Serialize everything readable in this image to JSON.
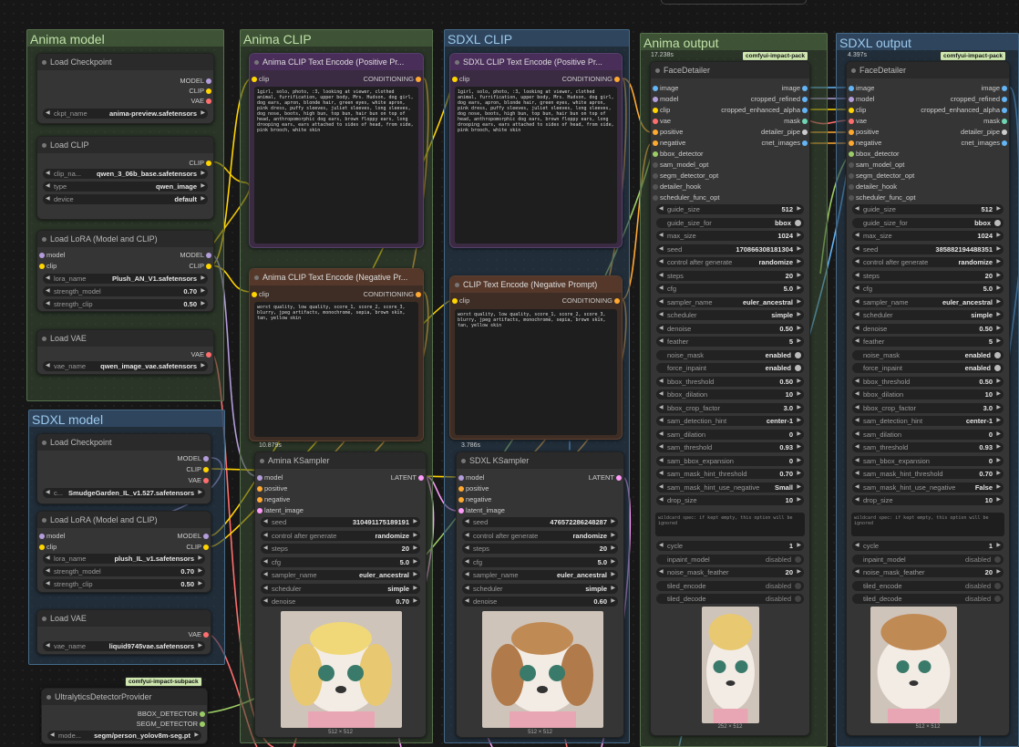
{
  "groups": {
    "anima_model": "Anima model",
    "anima_clip": "Anima CLIP",
    "sdxl_clip": "SDXL CLIP",
    "anima_output": "Anima output",
    "sdxl_output": "SDXL output",
    "sdxl_model": "SDXL model"
  },
  "nodes": {
    "anima_ckpt": {
      "title": "Load Checkpoint",
      "out": [
        "MODEL",
        "CLIP",
        "VAE"
      ],
      "ckpt_label": "ckpt_name",
      "ckpt_value": "anima-preview.safetensors"
    },
    "anima_clip_loader": {
      "title": "Load CLIP",
      "out": "CLIP",
      "name_label": "clip_na...",
      "name_value": "qwen_3_06b_base.safetensors",
      "type_label": "type",
      "type_value": "qwen_image",
      "device_label": "device",
      "device_value": "default"
    },
    "anima_lora": {
      "title": "Load LoRA (Model and CLIP)",
      "in_model": "model",
      "in_clip": "clip",
      "out_model": "MODEL",
      "out_clip": "CLIP",
      "lora_label": "lora_name",
      "lora_value": "Plush_AN_V1.safetensors",
      "sm_label": "strength_model",
      "sm_value": "0.70",
      "sc_label": "strength_clip",
      "sc_value": "0.50"
    },
    "anima_vae": {
      "title": "Load VAE",
      "out": "VAE",
      "label": "vae_name",
      "value": "qwen_image_vae.safetensors"
    },
    "anima_pos": {
      "title": "Anima CLIP Text Encode (Positive Pr...",
      "in": "clip",
      "out": "CONDITIONING",
      "text": "1girl, solo, photo, :3, looking at viewer, clothed animal, furrification, upper body, Mrs. Hudson, dog girl, dog ears, apron, blonde hair, green eyes, white apron, pink dress, puffy sleeves, juliet sleeves, long sleeves, dog nose, boots, high bun, top bun, hair bun on top of head, anthropomorphic dog ears, brown floppy ears, long drooping ears, ears attached to sides of head, from side, pink brooch, white skin"
    },
    "anima_neg": {
      "title": "Anima CLIP Text Encode (Negative Pr...",
      "in": "clip",
      "out": "CONDITIONING",
      "text": "worst quality, low quality, score_1, score_2, score_3, blurry, jpeg artifacts, monochrome, sepia, brown skin, tan, yellow skin",
      "timer": "10.879s"
    },
    "sdxl_pos": {
      "title": "SDXL CLIP Text Encode (Positive Pr...",
      "in": "clip",
      "out": "CONDITIONING",
      "text": "1girl, solo, photo, :3, looking at viewer, clothed animal, furrification, upper body, Mrs. Hudson, dog girl, dog ears, apron, blonde hair, green eyes, white apron, pink dress, puffy sleeves, juliet sleeves, long sleeves, dog nose, boots, high bun, top bun, hair bun on top of head, anthropomorphic dog ears, brown floppy ears, long drooping ears, ears attached to sides of head, from side, pink brooch, white skin"
    },
    "sdxl_neg": {
      "title": "CLIP Text Encode (Negative Prompt)",
      "in": "clip",
      "out": "CONDITIONING",
      "text": "worst quality, low quality, score_1, score_2, score_3, blurry, jpeg artifacts, monochrome, sepia, brown skin, tan, yellow skin",
      "timer": "3.786s"
    },
    "anima_ks": {
      "title": "Amina KSampler",
      "in": [
        "model",
        "positive",
        "negative",
        "latent_image"
      ],
      "out": "LATENT",
      "w": [
        [
          "seed",
          "310491175189191"
        ],
        [
          "control after generate",
          "randomize"
        ],
        [
          "steps",
          "20"
        ],
        [
          "cfg",
          "5.0"
        ],
        [
          "sampler_name",
          "euler_ancestral"
        ],
        [
          "scheduler",
          "simple"
        ],
        [
          "denoise",
          "0.70"
        ]
      ],
      "size": "512 × 512"
    },
    "sdxl_ks": {
      "title": "SDXL KSampler",
      "in": [
        "model",
        "positive",
        "negative",
        "latent_image"
      ],
      "out": "LATENT",
      "w": [
        [
          "seed",
          "476572286248287"
        ],
        [
          "control after generate",
          "randomize"
        ],
        [
          "steps",
          "20"
        ],
        [
          "cfg",
          "5.0"
        ],
        [
          "sampler_name",
          "euler_ancestral"
        ],
        [
          "scheduler",
          "simple"
        ],
        [
          "denoise",
          "0.60"
        ]
      ],
      "size": "512 × 512"
    },
    "sdxl_ckpt": {
      "title": "Load Checkpoint",
      "out": [
        "MODEL",
        "CLIP",
        "VAE"
      ],
      "ckpt_label": "c...",
      "ckpt_value": "SmudgeGarden_IL_v1.527.safetensors"
    },
    "sdxl_lora": {
      "title": "Load LoRA (Model and CLIP)",
      "in_model": "model",
      "in_clip": "clip",
      "out_model": "MODEL",
      "out_clip": "CLIP",
      "lora_label": "lora_name",
      "lora_value": "plush_IL_v1.safetensors",
      "sm_label": "strength_model",
      "sm_value": "0.70",
      "sc_label": "strength_clip",
      "sc_value": "0.50"
    },
    "sdxl_vae": {
      "title": "Load VAE",
      "out": "VAE",
      "label": "vae_name",
      "value": "liquid9745vae.safetensors"
    },
    "detector": {
      "pack": "comfyui-impact-subpack",
      "title": "UltralyticsDetectorProvider",
      "out": [
        "BBOX_DETECTOR",
        "SEGM_DETECTOR"
      ],
      "label": "mode...",
      "value": "segm/person_yolov8m-seg.pt"
    },
    "anima_fd": {
      "timer": "17.238s",
      "pack": "comfyui-impact-pack",
      "title": "FaceDetailer",
      "in": [
        "image",
        "model",
        "clip",
        "vae",
        "positive",
        "negative",
        "bbox_detector",
        "sam_model_opt",
        "segm_detector_opt",
        "detailer_hook",
        "scheduler_func_opt"
      ],
      "out": [
        "image",
        "cropped_refined",
        "cropped_enhanced_alpha",
        "mask",
        "detailer_pipe",
        "cnet_images"
      ],
      "w": [
        [
          "guide_size",
          "512",
          "n"
        ],
        [
          "guide_size_for",
          "bbox",
          "t"
        ],
        [
          "max_size",
          "1024",
          "n"
        ],
        [
          "seed",
          "170866308181304",
          "n"
        ],
        [
          "control after generate",
          "randomize",
          "n"
        ],
        [
          "steps",
          "20",
          "n"
        ],
        [
          "cfg",
          "5.0",
          "n"
        ],
        [
          "sampler_name",
          "euler_ancestral",
          "n"
        ],
        [
          "scheduler",
          "simple",
          "n"
        ],
        [
          "denoise",
          "0.50",
          "n"
        ],
        [
          "feather",
          "5",
          "n"
        ],
        [
          "noise_mask",
          "enabled",
          "t"
        ],
        [
          "force_inpaint",
          "enabled",
          "t"
        ],
        [
          "bbox_threshold",
          "0.50",
          "n"
        ],
        [
          "bbox_dilation",
          "10",
          "n"
        ],
        [
          "bbox_crop_factor",
          "3.0",
          "n"
        ],
        [
          "sam_detection_hint",
          "center-1",
          "n"
        ],
        [
          "sam_dilation",
          "0",
          "n"
        ],
        [
          "sam_threshold",
          "0.93",
          "n"
        ],
        [
          "sam_bbox_expansion",
          "0",
          "n"
        ],
        [
          "sam_mask_hint_threshold",
          "0.70",
          "n"
        ],
        [
          "sam_mask_hint_use_negative",
          "Small",
          "n"
        ],
        [
          "drop_size",
          "10",
          "n"
        ]
      ],
      "wildcard": "wildcard spec: if kept empty, this option will be ignored",
      "w2": [
        [
          "cycle",
          "1",
          "n"
        ],
        [
          "inpaint_model",
          "disabled",
          "d"
        ],
        [
          "noise_mask_feather",
          "20",
          "n"
        ],
        [
          "tiled_encode",
          "disabled",
          "d"
        ],
        [
          "tiled_decode",
          "disabled",
          "d"
        ]
      ],
      "size": "252 × 512"
    },
    "sdxl_fd": {
      "timer": "4.397s",
      "pack": "comfyui-impact-pack",
      "title": "FaceDetailer",
      "in": [
        "image",
        "model",
        "clip",
        "vae",
        "positive",
        "negative",
        "bbox_detector",
        "sam_model_opt",
        "segm_detector_opt",
        "detailer_hook",
        "scheduler_func_opt"
      ],
      "out": [
        "image",
        "cropped_refined",
        "cropped_enhanced_alpha",
        "mask",
        "detailer_pipe",
        "cnet_images"
      ],
      "w": [
        [
          "guide_size",
          "512",
          "n"
        ],
        [
          "guide_size_for",
          "bbox",
          "t"
        ],
        [
          "max_size",
          "1024",
          "n"
        ],
        [
          "seed",
          "385882194488351",
          "n"
        ],
        [
          "control after generate",
          "randomize",
          "n"
        ],
        [
          "steps",
          "20",
          "n"
        ],
        [
          "cfg",
          "5.0",
          "n"
        ],
        [
          "sampler_name",
          "euler_ancestral",
          "n"
        ],
        [
          "scheduler",
          "simple",
          "n"
        ],
        [
          "denoise",
          "0.50",
          "n"
        ],
        [
          "feather",
          "5",
          "n"
        ],
        [
          "noise_mask",
          "enabled",
          "t"
        ],
        [
          "force_inpaint",
          "enabled",
          "t"
        ],
        [
          "bbox_threshold",
          "0.50",
          "n"
        ],
        [
          "bbox_dilation",
          "10",
          "n"
        ],
        [
          "bbox_crop_factor",
          "3.0",
          "n"
        ],
        [
          "sam_detection_hint",
          "center-1",
          "n"
        ],
        [
          "sam_dilation",
          "0",
          "n"
        ],
        [
          "sam_threshold",
          "0.93",
          "n"
        ],
        [
          "sam_bbox_expansion",
          "0",
          "n"
        ],
        [
          "sam_mask_hint_threshold",
          "0.70",
          "n"
        ],
        [
          "sam_mask_hint_use_negative",
          "False",
          "n"
        ],
        [
          "drop_size",
          "10",
          "n"
        ]
      ],
      "wildcard": "wildcard spec: if kept empty, this option will be ignored",
      "w2": [
        [
          "cycle",
          "1",
          "n"
        ],
        [
          "inpaint_model",
          "disabled",
          "d"
        ],
        [
          "noise_mask_feather",
          "20",
          "n"
        ],
        [
          "tiled_encode",
          "disabled",
          "d"
        ],
        [
          "tiled_decode",
          "disabled",
          "d"
        ]
      ],
      "size": "512 × 512"
    }
  },
  "colors": {
    "model": "#b39ddb",
    "clip": "#ffd500",
    "vae": "#ff6e6e",
    "conditioning": "#ffa931",
    "latent": "#ff9cf9",
    "image": "#64b5f6",
    "detector": "#9ccc65"
  }
}
